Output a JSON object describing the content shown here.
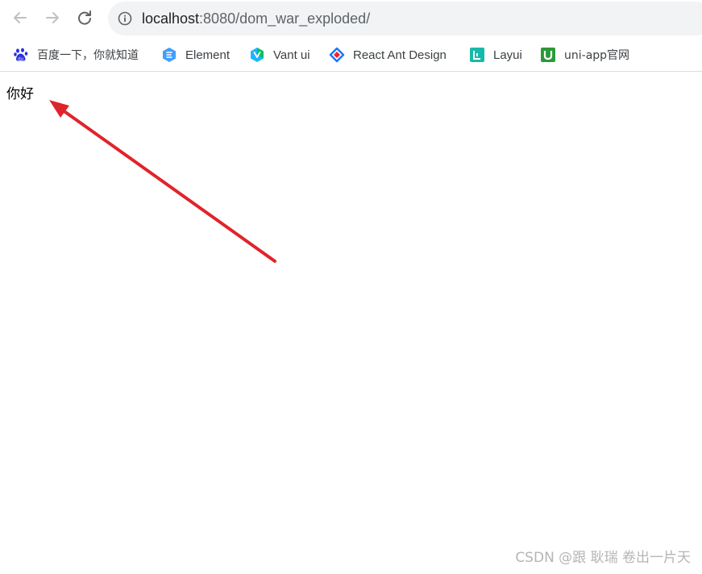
{
  "browser": {
    "url_host": "localhost",
    "url_path": ":8080/dom_war_exploded/",
    "nav": {
      "back_icon": "arrow-left-icon",
      "forward_icon": "arrow-right-icon",
      "reload_icon": "reload-icon",
      "info_icon": "info-icon"
    }
  },
  "bookmarks": [
    {
      "label": "百度一下，你就知道",
      "icon": "baidu-paw-icon",
      "color": "#2932e1"
    },
    {
      "label": "Element",
      "icon": "element-icon",
      "color": "#409eff"
    },
    {
      "label": "Vant ui",
      "icon": "vant-icon",
      "color": "#07c160"
    },
    {
      "label": "React Ant Design",
      "icon": "ant-design-icon",
      "color": "#1677ff"
    },
    {
      "label": "Layui",
      "icon": "layui-icon",
      "color": "#16baaa"
    },
    {
      "label": "uni-app官网",
      "icon": "uniapp-icon",
      "color": "#2b9939"
    }
  ],
  "page": {
    "text": "你好",
    "annotation_color": "#e0242b"
  },
  "watermark": "CSDN @跟 耿瑞 卷出一片天"
}
